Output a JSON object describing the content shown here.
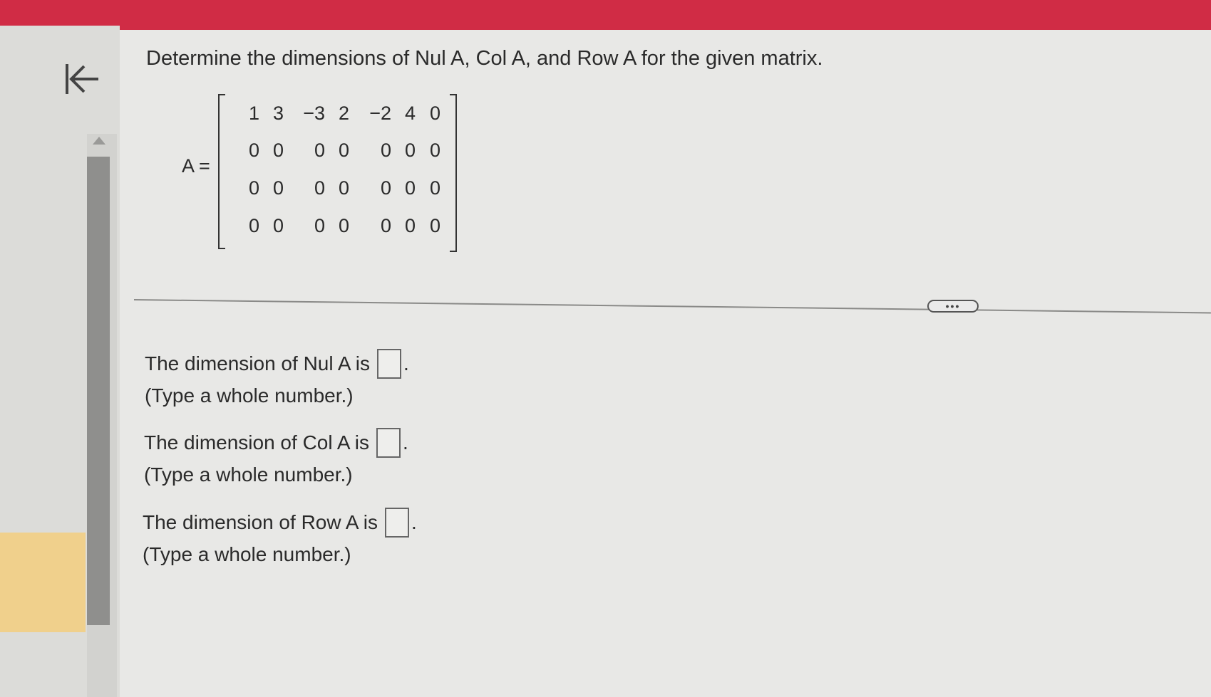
{
  "question": "Determine the dimensions of Nul A, Col A, and Row A for the given matrix.",
  "matrix": {
    "label": "A =",
    "rows": [
      [
        "1",
        "3",
        "−3",
        "2",
        "−2",
        "4",
        "0"
      ],
      [
        "0",
        "0",
        "0",
        "0",
        "0",
        "0",
        "0"
      ],
      [
        "0",
        "0",
        "0",
        "0",
        "0",
        "0",
        "0"
      ],
      [
        "0",
        "0",
        "0",
        "0",
        "0",
        "0",
        "0"
      ]
    ]
  },
  "more_button": "•••",
  "answers": [
    {
      "prompt": "The dimension of Nul A is",
      "value": "",
      "suffix": ".",
      "hint": "(Type a whole number.)"
    },
    {
      "prompt": "The dimension of Col A is",
      "value": "",
      "suffix": ".",
      "hint": "(Type a whole number.)"
    },
    {
      "prompt": "The dimension of Row A is",
      "value": "",
      "suffix": ".",
      "hint": "(Type a whole number.)"
    }
  ],
  "colors": {
    "topbar": "#d02c45",
    "yellow_panel": "#f0d08c"
  }
}
